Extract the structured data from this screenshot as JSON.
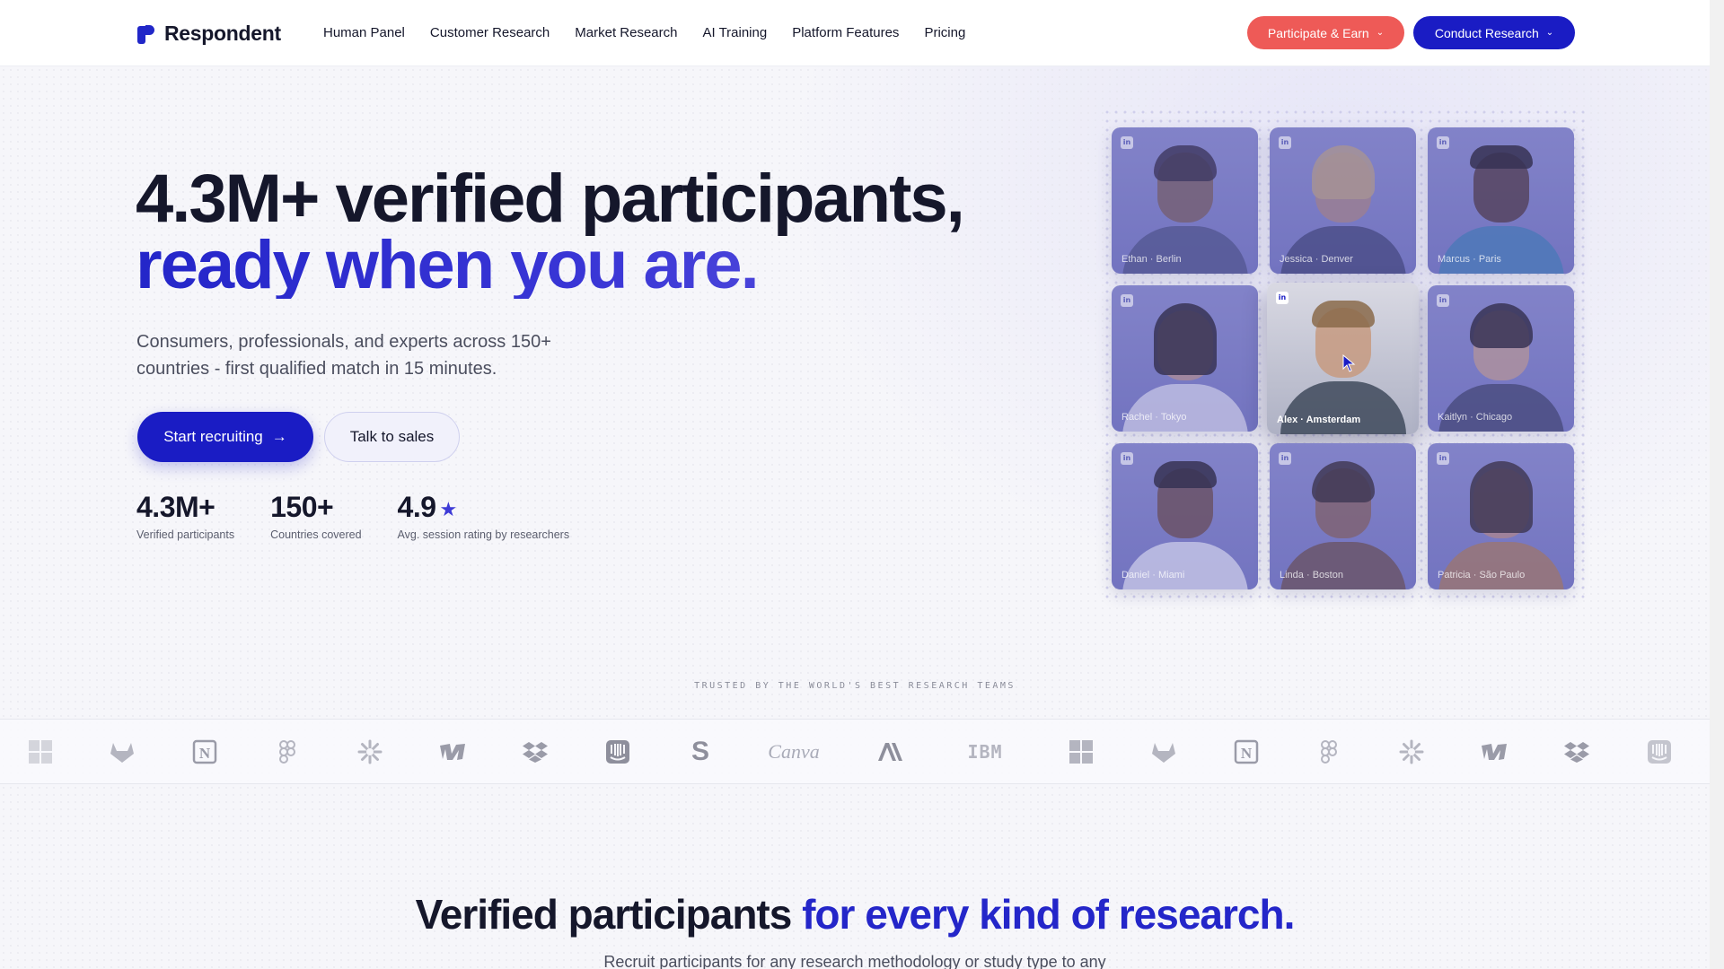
{
  "header": {
    "brand": "Respondent",
    "nav": [
      "Human Panel",
      "Customer Research",
      "Market Research",
      "AI Training",
      "Platform Features",
      "Pricing"
    ],
    "participate_label": "Participate & Earn",
    "conduct_label": "Conduct Research"
  },
  "hero": {
    "title_line1": "4.3M+ verified participants,",
    "title_line2": "ready when you are.",
    "subtitle": "Consumers, professionals, and experts across 150+ countries - first qualified match in 15 minutes.",
    "start_label": "Start recruiting",
    "sales_label": "Talk to sales",
    "stats": [
      {
        "value": "4.3M+",
        "label": "Verified participants"
      },
      {
        "value": "150+",
        "label": "Countries covered"
      },
      {
        "value": "4.9",
        "label": "Avg. session rating by researchers"
      }
    ]
  },
  "participants": [
    {
      "caption": "Ethan · Berlin"
    },
    {
      "caption": "Jessica · Denver"
    },
    {
      "caption": "Marcus · Paris"
    },
    {
      "caption": "Rachel · Tokyo"
    },
    {
      "caption": "Alex · Amsterdam"
    },
    {
      "caption": "Kaitlyn · Chicago"
    },
    {
      "caption": "Daniel · Miami"
    },
    {
      "caption": "Linda · Boston"
    },
    {
      "caption": "Patricia · São Paulo"
    }
  ],
  "trusted_label": "TRUSTED BY THE WORLD'S BEST RESEARCH TEAMS",
  "brands": [
    "microsoft-icon",
    "gitlab-icon",
    "notion-icon",
    "figma-icon",
    "zapier-icon",
    "webflow-icon",
    "dropbox-icon",
    "intercom-icon",
    "S",
    "Canva",
    "anthropic-icon",
    "IBM",
    "microsoft-icon",
    "gitlab-icon",
    "notion-icon",
    "figma-icon",
    "zapier-icon",
    "webflow-icon",
    "dropbox-icon",
    "intercom-icon"
  ],
  "section": {
    "title_dark": "Verified participants",
    "title_blue": "for every kind of research.",
    "subtitle": "Recruit participants for any research methodology or study type to any"
  }
}
